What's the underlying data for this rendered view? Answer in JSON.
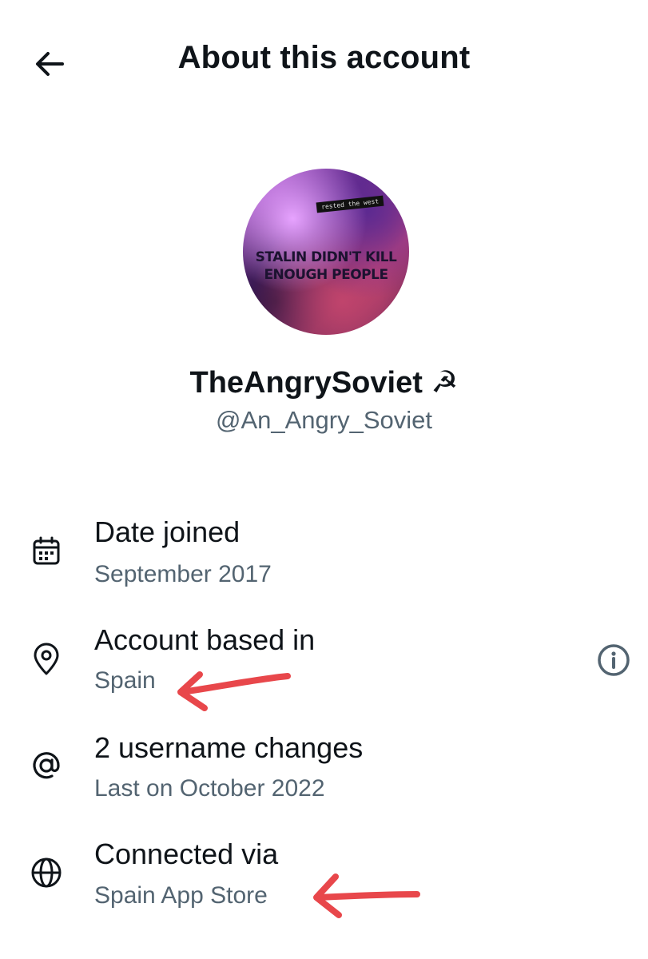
{
  "header": {
    "title": "About this account",
    "back_icon": "arrow-left-icon"
  },
  "profile": {
    "avatar_caption": "rested the west",
    "avatar_slogan_line1": "STALIN DIDN'T KILL",
    "avatar_slogan_line2": "ENOUGH PEOPLE",
    "display_name": "TheAngrySoviet ☭",
    "handle": "@An_Angry_Soviet"
  },
  "info": {
    "date_joined": {
      "label": "Date joined",
      "value": "September 2017",
      "icon": "calendar-icon"
    },
    "based_in": {
      "label": "Account based in",
      "value": "Spain",
      "icon": "location-pin-icon",
      "info_icon": "info-circle-icon"
    },
    "username_changes": {
      "label": "2 username changes",
      "value": "Last on October 2022",
      "icon": "at-sign-icon"
    },
    "connected_via": {
      "label": "Connected via",
      "value": "Spain App Store",
      "icon": "globe-icon"
    }
  },
  "colors": {
    "text_primary": "#0f1419",
    "text_secondary": "#536471",
    "annotation_arrow": "#e8474b"
  }
}
